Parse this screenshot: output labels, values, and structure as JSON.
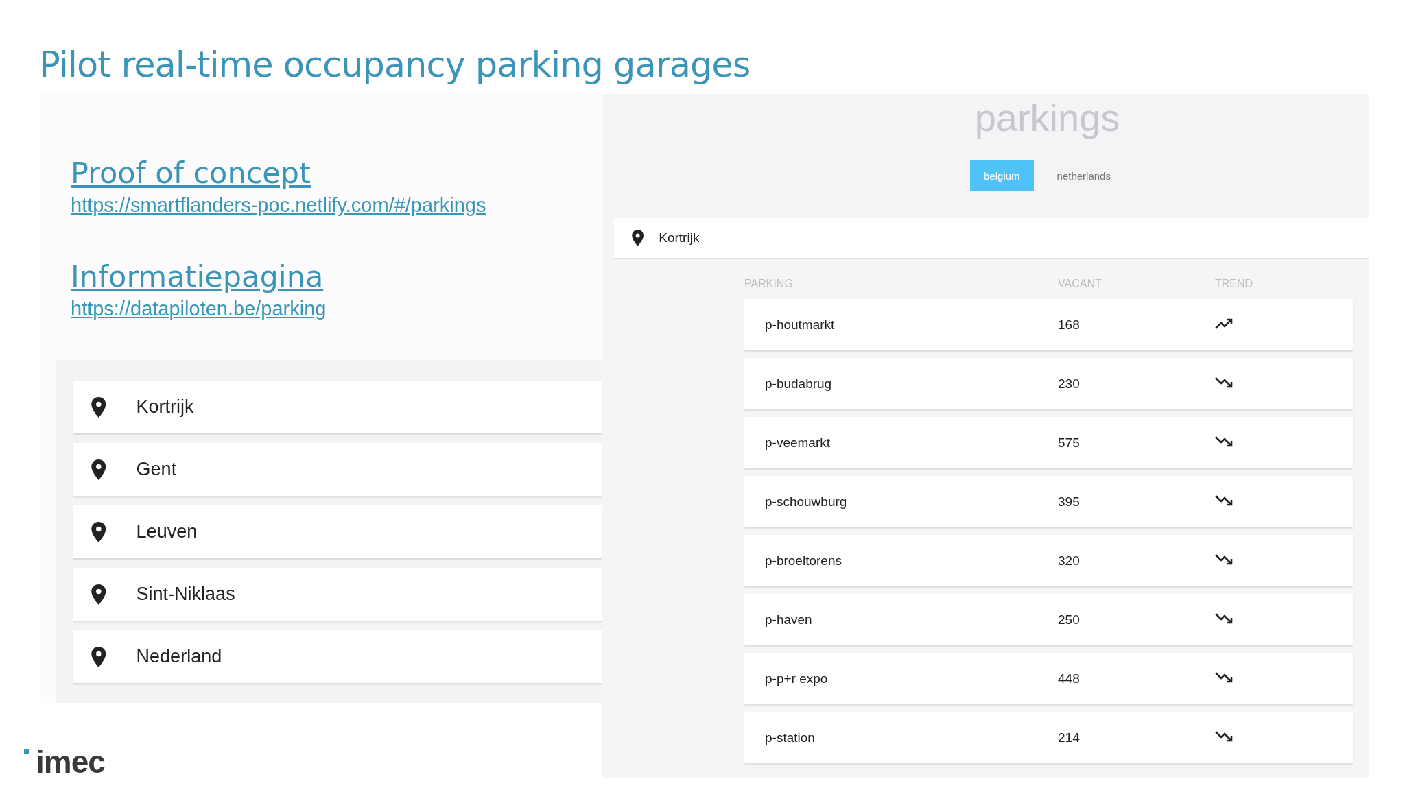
{
  "slide_title": "Pilot real-time occupancy parking garages",
  "links": [
    {
      "heading": "Proof of concept",
      "url": "https://smartflanders-poc.netlify.com/#/parkings"
    },
    {
      "heading": "Informatiepagina",
      "url": "https://datapiloten.be/parking"
    }
  ],
  "cities": [
    "Kortrijk",
    "Gent",
    "Leuven",
    "Sint-Niklaas",
    "Nederland"
  ],
  "app": {
    "title": "parkings",
    "tabs": [
      {
        "label": "belgium",
        "selected": true
      },
      {
        "label": "netherlands",
        "selected": false
      }
    ],
    "city": "Kortrijk",
    "columns": [
      "PARKING",
      "VACANT",
      "TREND"
    ],
    "rows": [
      {
        "name": "p-houtmarkt",
        "vacant": "168",
        "kind": "up"
      },
      {
        "name": "p-budabrug",
        "vacant": "230",
        "kind": "down"
      },
      {
        "name": "p-veemarkt",
        "vacant": "575",
        "kind": "down"
      },
      {
        "name": "p-schouwburg",
        "vacant": "395",
        "kind": "down"
      },
      {
        "name": "p-broeltorens",
        "vacant": "320",
        "kind": "down"
      },
      {
        "name": "p-haven",
        "vacant": "250",
        "kind": "down"
      },
      {
        "name": "p-p+r expo",
        "vacant": "448",
        "kind": "down"
      },
      {
        "name": "p-station",
        "vacant": "214",
        "kind": "down"
      }
    ]
  },
  "logo": "imec"
}
